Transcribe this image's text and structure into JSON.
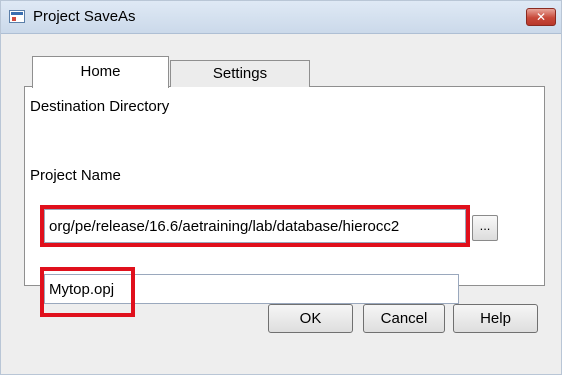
{
  "window": {
    "title": "Project SaveAs",
    "close_label": "✕"
  },
  "tabs": [
    {
      "label": "Home",
      "active": true
    },
    {
      "label": "Settings",
      "active": false
    }
  ],
  "form": {
    "destination_label": "Destination Directory",
    "destination_value": "org/pe/release/16.6/aetraining/lab/database/hierocc2",
    "browse_label": "...",
    "project_name_label": "Project Name",
    "project_name_value": "Mytop.opj"
  },
  "buttons": {
    "ok": "OK",
    "cancel": "Cancel",
    "help": "Help"
  },
  "colors": {
    "highlight": "#e0101c",
    "titlebar": "#cbd9ea",
    "close": "#c8493a"
  }
}
